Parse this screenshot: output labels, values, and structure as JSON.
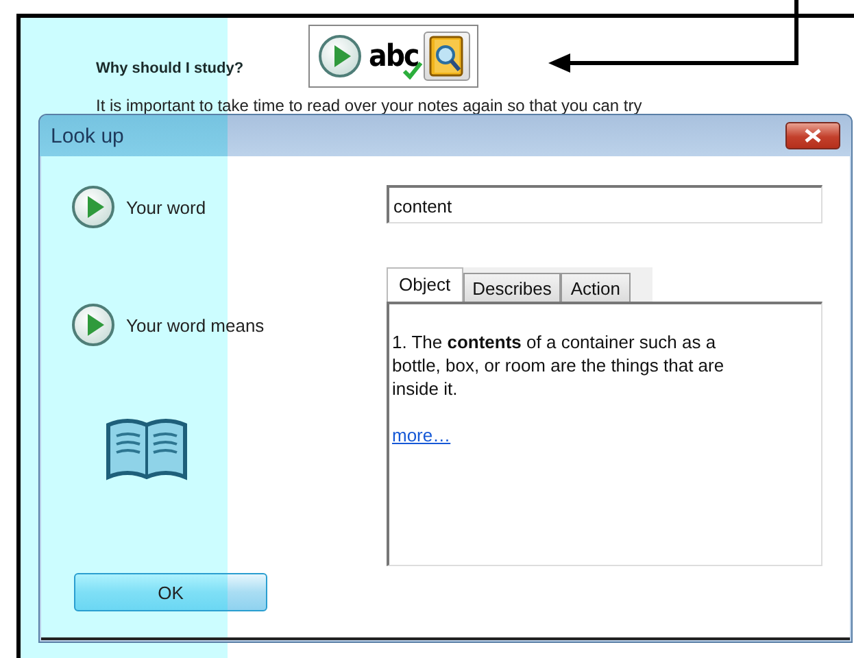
{
  "document": {
    "heading": "Why should I study?",
    "toolbar": [
      {
        "kind": "play",
        "selected": false
      },
      {
        "kind": "spell-check",
        "label": "abc",
        "selected": false
      },
      {
        "kind": "look-up",
        "selected": true
      }
    ],
    "paragraph": "It is important to take time to read over your notes again so that you can try"
  },
  "dialog": {
    "title": "Look up",
    "rows": [
      {
        "label": "Your word"
      },
      {
        "label": "Your word means"
      }
    ],
    "word_field": {
      "value": "content"
    },
    "tabs": [
      {
        "label": "Object",
        "selected": true
      },
      {
        "label": "Describes",
        "selected": false
      },
      {
        "label": "Action",
        "selected": false
      }
    ],
    "definition": "1. The **contents** of a container such as a bottle, box, or room are the things that are inside it.",
    "more_link": "more…",
    "ok_button": "OK"
  }
}
